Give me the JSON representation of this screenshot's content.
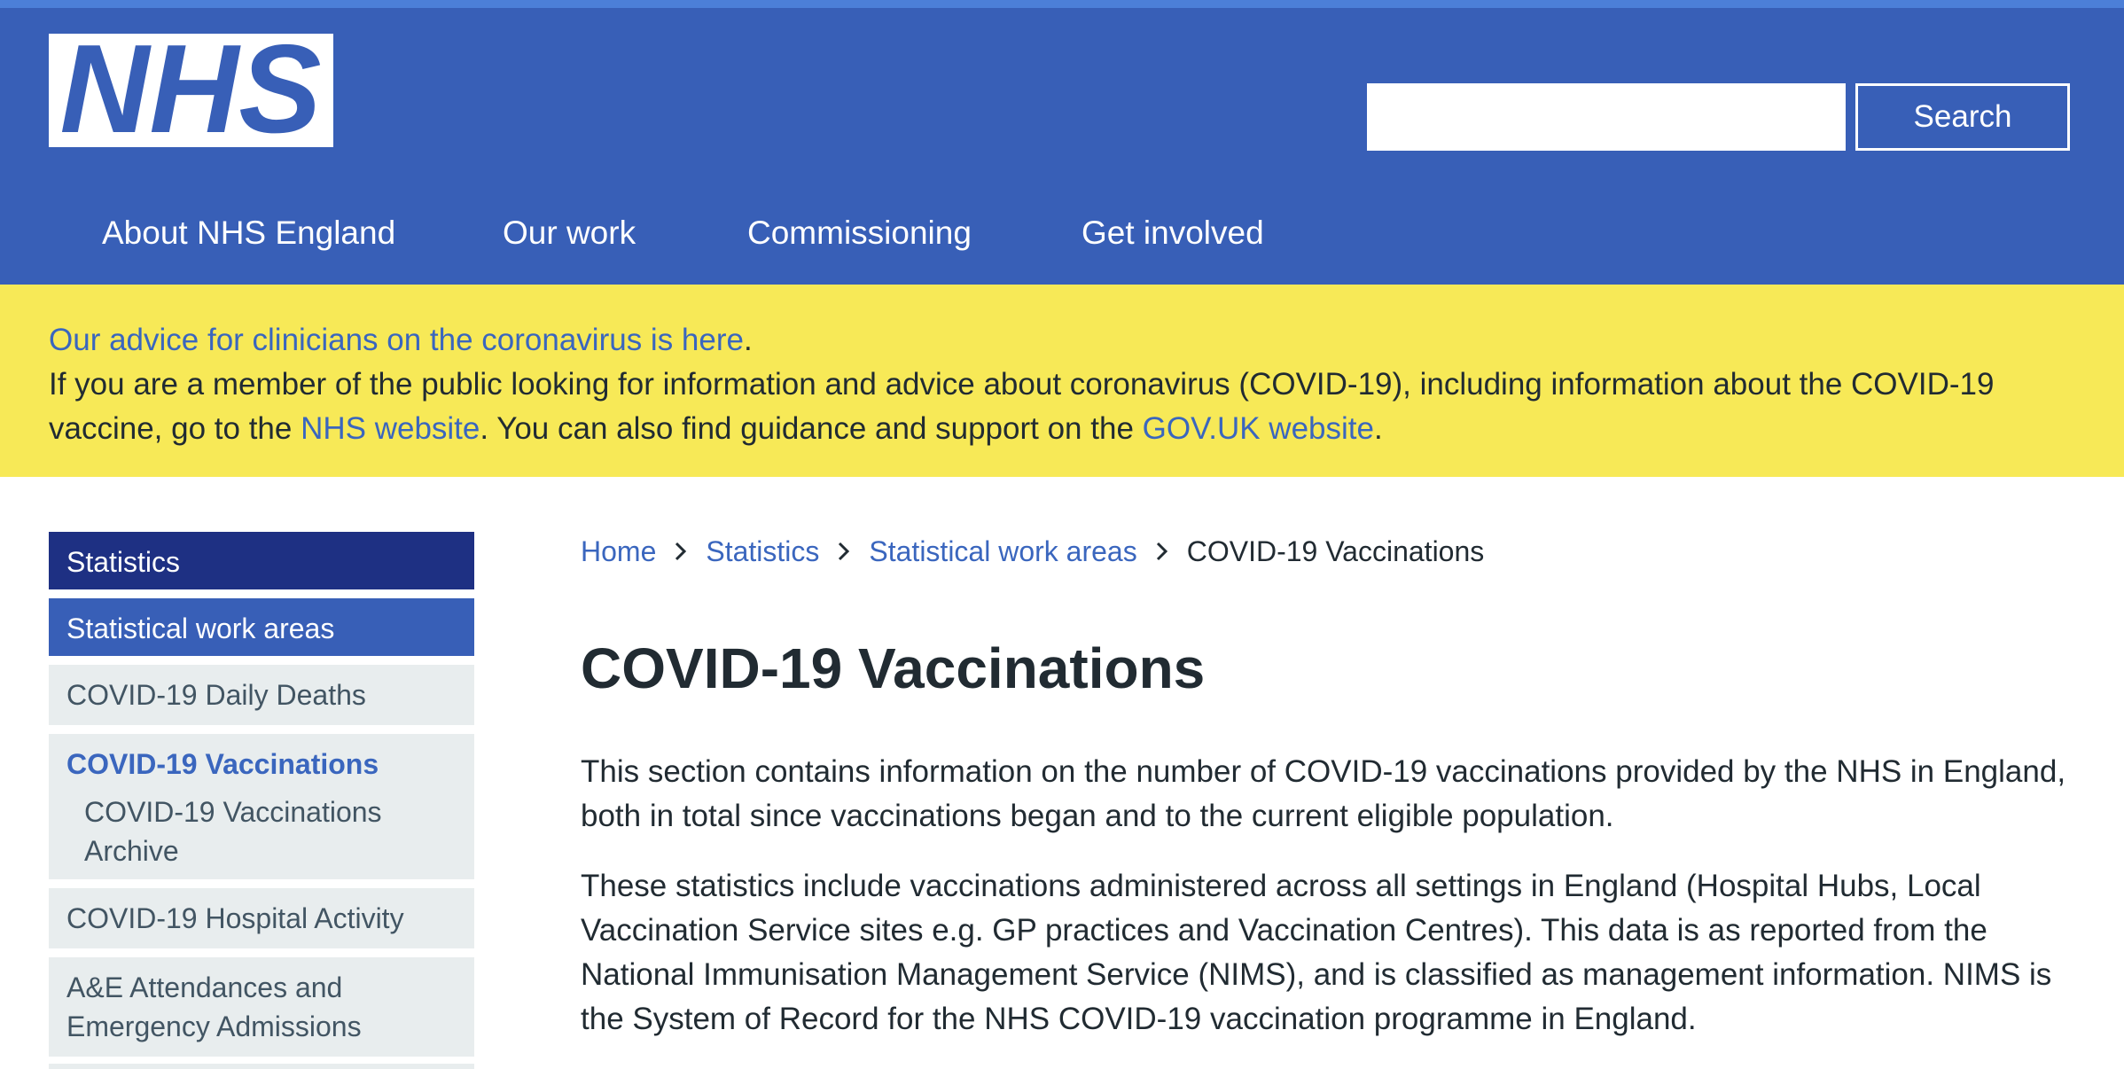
{
  "header": {
    "logo_text": "NHS",
    "search": {
      "value": "",
      "placeholder": "",
      "button_label": "Search"
    },
    "nav": [
      {
        "label": "About NHS England"
      },
      {
        "label": "Our work"
      },
      {
        "label": "Commissioning"
      },
      {
        "label": "Get involved"
      }
    ]
  },
  "banner": {
    "clinician_link": "Our advice for clinicians on the coronavirus is here",
    "clinician_suffix": ".",
    "public_text_1": "If you are a member of the public looking for information and advice about coronavirus (COVID-19), including information about the COVID-19 vaccine, go to the ",
    "nhs_link": "NHS website",
    "public_text_2": ". You can also find guidance and support on the ",
    "gov_link": "GOV.UK website",
    "public_text_3": "."
  },
  "sidebar": {
    "items": [
      {
        "label": "Statistics"
      },
      {
        "label": "Statistical work areas"
      },
      {
        "label": "COVID-19 Daily Deaths"
      },
      {
        "label": "COVID-19 Vaccinations",
        "sub": "COVID-19 Vaccinations Archive"
      },
      {
        "label": "COVID-19 Hospital Activity"
      },
      {
        "label": "A&E Attendances and Emergency Admissions"
      }
    ]
  },
  "breadcrumb": {
    "items": [
      "Home",
      "Statistics",
      "Statistical work areas"
    ],
    "current": "COVID-19 Vaccinations"
  },
  "main": {
    "title": "COVID-19 Vaccinations",
    "paragraphs": [
      "This section contains information on the number of COVID-19 vaccinations provided by the NHS in England, both in total since vaccinations began and to the current eligible population.",
      "These statistics include vaccinations administered across all settings in England (Hospital Hubs, Local Vaccination Service sites e.g. GP practices and Vaccination Centres). This data is as reported from the National Immunisation Management Service (NIMS), and is classified as management information. NIMS is the System of Record for the NHS COVID-19 vaccination programme in England."
    ]
  },
  "colors": {
    "header_blue": "#385fb7",
    "top_strip": "#4c7fd8",
    "banner_yellow": "#f7e957",
    "link_blue": "#3a66be",
    "sidebar_dark": "#1e3083",
    "sidebar_light": "#e8edee"
  }
}
